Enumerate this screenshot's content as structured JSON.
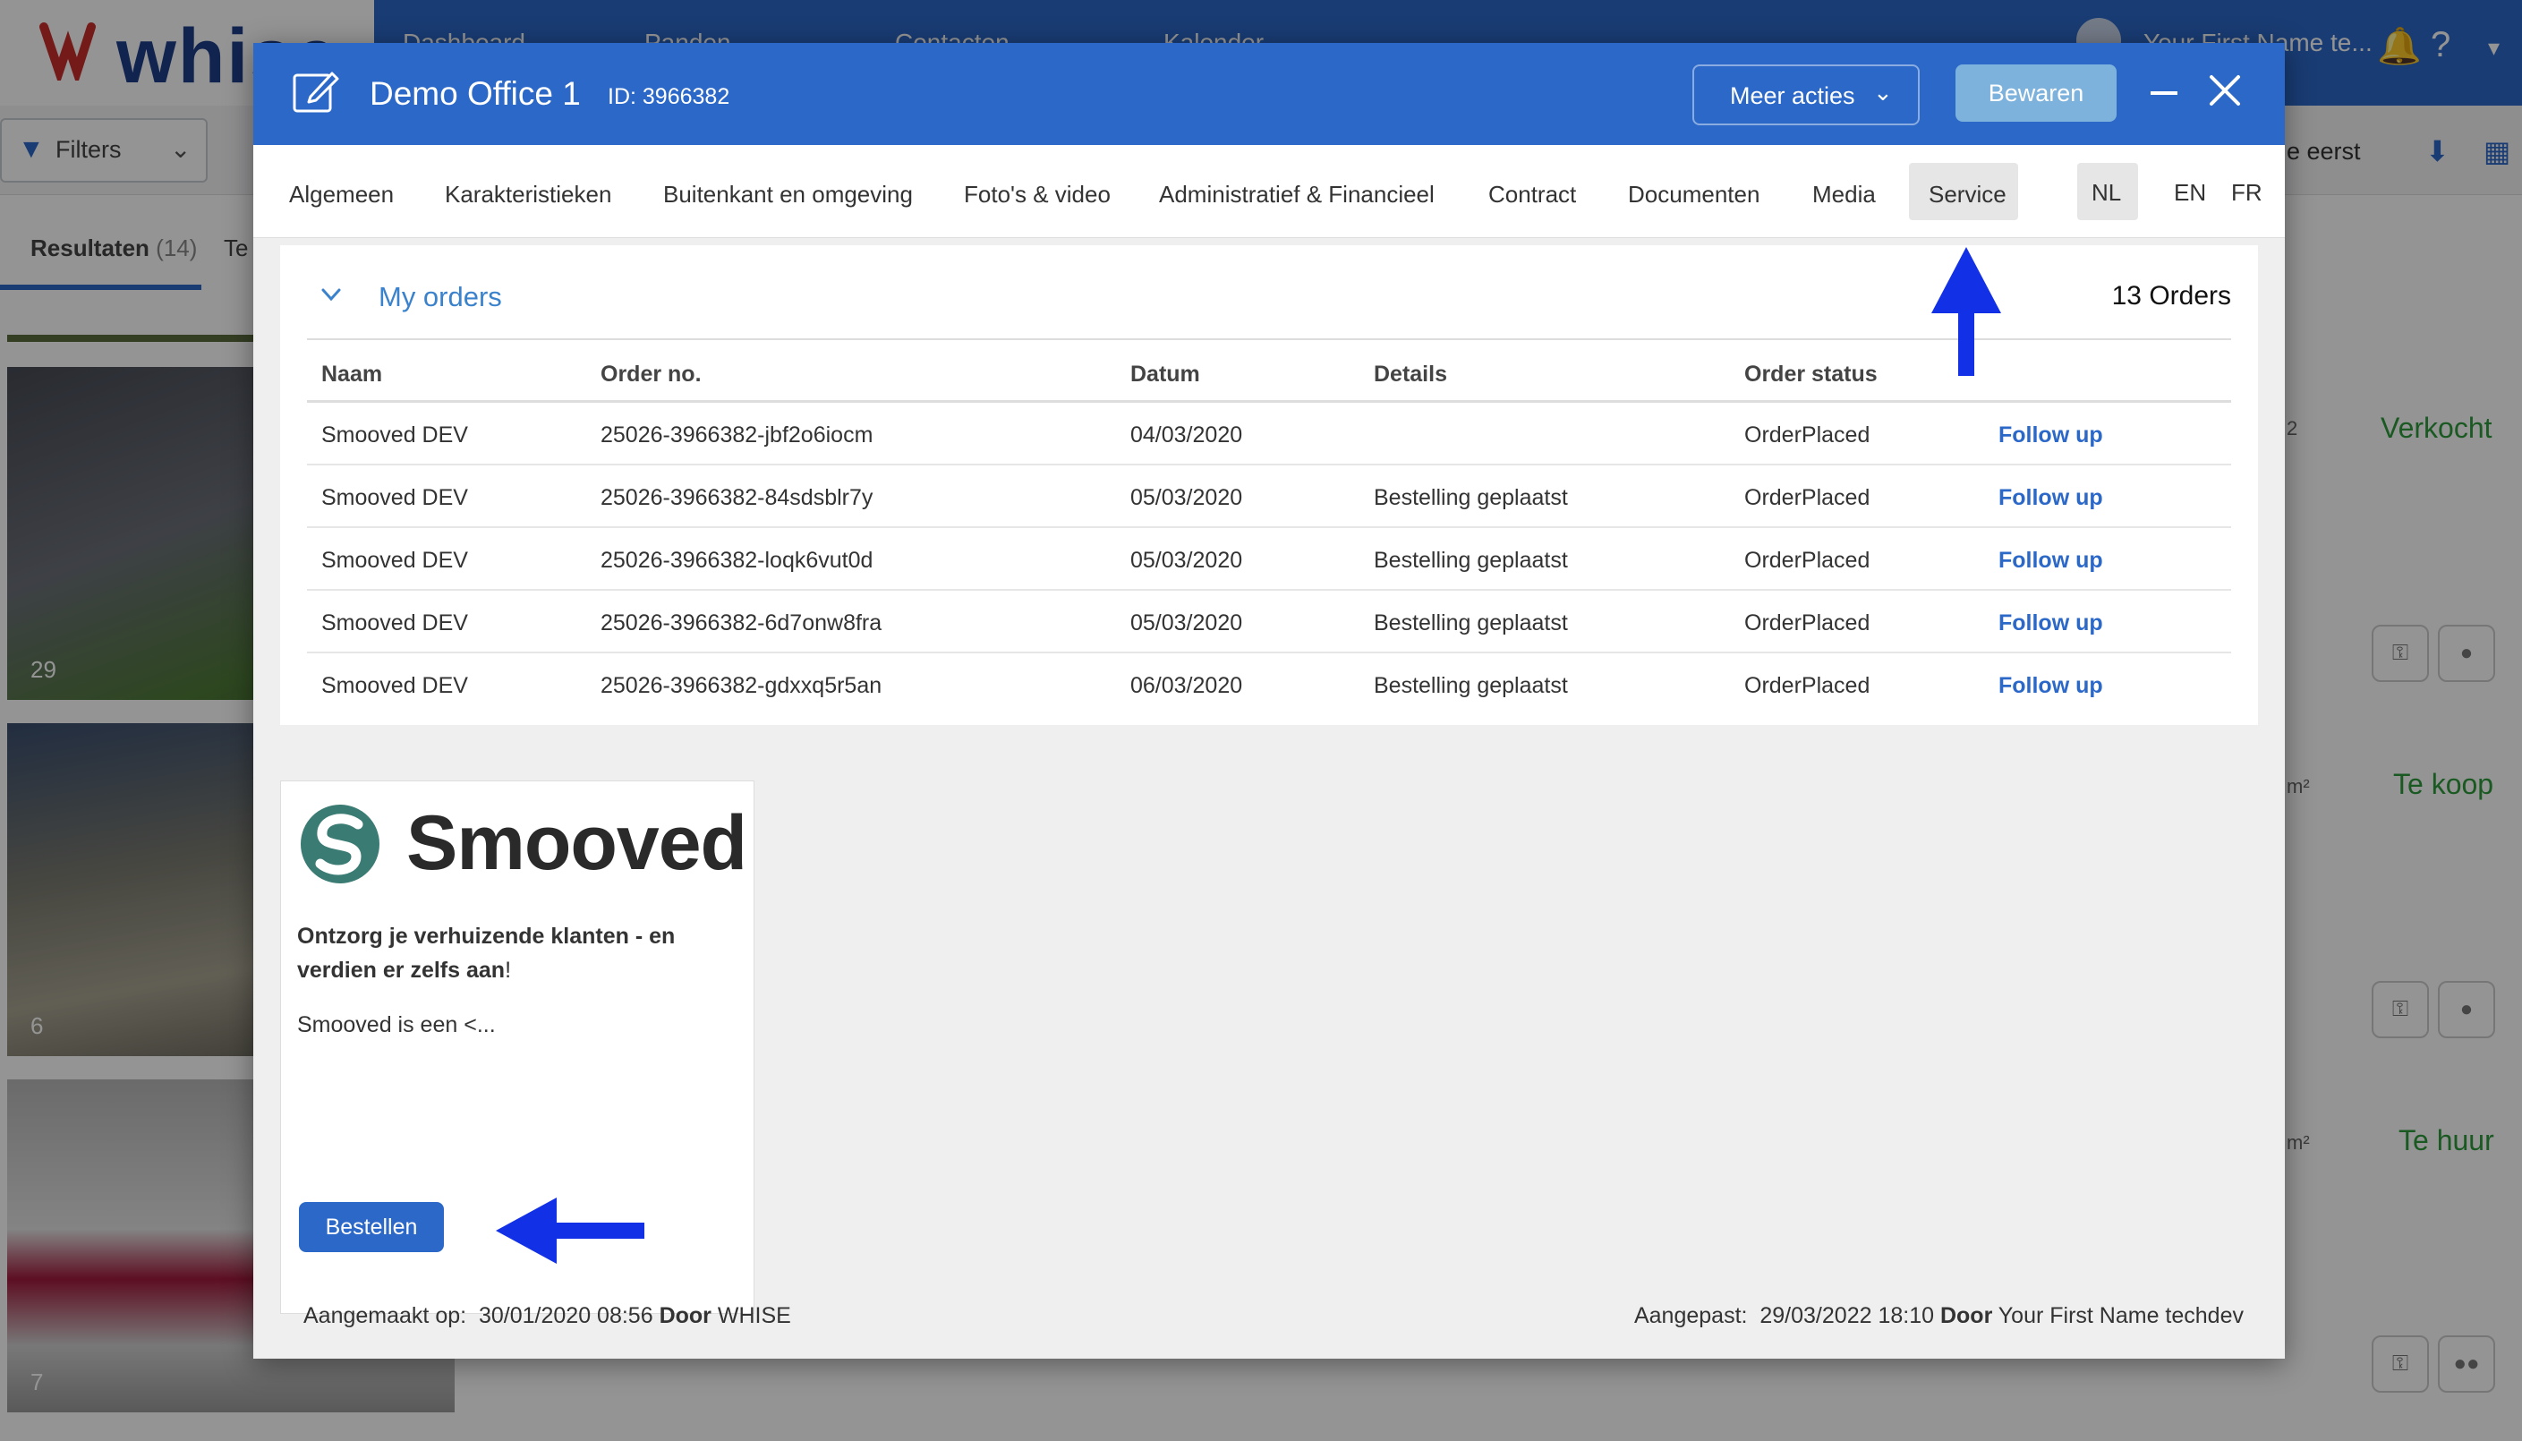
{
  "background": {
    "logo": "whise",
    "nav": [
      "Dashboard",
      "Panden",
      "Contacten",
      "Kalender"
    ],
    "user_name": "Your First Name te...",
    "filters_label": "Filters",
    "results_tab": "Resultaten",
    "results_count": "(14)",
    "second_tab": "Te",
    "sort_label": "e eerst",
    "thumbs": [
      {
        "count": "29",
        "status": "Verkocht"
      },
      {
        "count": "6",
        "status": "Te koop"
      },
      {
        "count": "7",
        "status": "Te huur"
      }
    ],
    "m2_a": "2",
    "m2_b": "m²",
    "m2_c": "m²"
  },
  "modal": {
    "title": "Demo Office 1",
    "id_label": "ID: 3966382",
    "more_actions": "Meer acties",
    "save": "Bewaren",
    "tabs": [
      "Algemeen",
      "Karakteristieken",
      "Buitenkant en omgeving",
      "Foto's & video",
      "Administratief & Financieel",
      "Contract",
      "Documenten",
      "Media",
      "Service"
    ],
    "languages": [
      "NL",
      "EN",
      "FR"
    ],
    "active_tab": "Service",
    "active_language": "NL"
  },
  "orders": {
    "title": "My orders",
    "count": "13 Orders",
    "columns": [
      "Naam",
      "Order no.",
      "Datum",
      "Details",
      "Order status"
    ],
    "rows": [
      {
        "naam": "Smooved DEV",
        "order_no": "25026-3966382-jbf2o6iocm",
        "datum": "04/03/2020",
        "details": "",
        "status": "OrderPlaced",
        "action": "Follow up"
      },
      {
        "naam": "Smooved DEV",
        "order_no": "25026-3966382-84sdsblr7y",
        "datum": "05/03/2020",
        "details": "Bestelling geplaatst",
        "status": "OrderPlaced",
        "action": "Follow up"
      },
      {
        "naam": "Smooved DEV",
        "order_no": "25026-3966382-loqk6vut0d",
        "datum": "05/03/2020",
        "details": "Bestelling geplaatst",
        "status": "OrderPlaced",
        "action": "Follow up"
      },
      {
        "naam": "Smooved DEV",
        "order_no": "25026-3966382-6d7onw8fra",
        "datum": "05/03/2020",
        "details": "Bestelling geplaatst",
        "status": "OrderPlaced",
        "action": "Follow up"
      },
      {
        "naam": "Smooved DEV",
        "order_no": "25026-3966382-gdxxq5r5an",
        "datum": "06/03/2020",
        "details": "Bestelling geplaatst",
        "status": "OrderPlaced",
        "action": "Follow up"
      }
    ]
  },
  "service_card": {
    "brand": "Smooved",
    "headline": "Ontzorg je verhuizende klanten - en verdien er zelfs aan",
    "headline_suffix": "!",
    "description": "Smooved is een <...",
    "order_button": "Bestellen"
  },
  "footer": {
    "created_label": "Aangemaakt op:",
    "created_date": "30/01/2020 08:56",
    "created_by_label": "Door",
    "created_by": "WHISE",
    "modified_label": "Aangepast:",
    "modified_date": "29/03/2022 18:10",
    "modified_by_label": "Door",
    "modified_by": "Your First Name techdev"
  },
  "colors": {
    "primary": "#2b68c8",
    "save_button": "#7db2dd",
    "link": "#2b68c8",
    "status_green": "#2e9a3c",
    "annotation_arrow": "#1230e6"
  }
}
